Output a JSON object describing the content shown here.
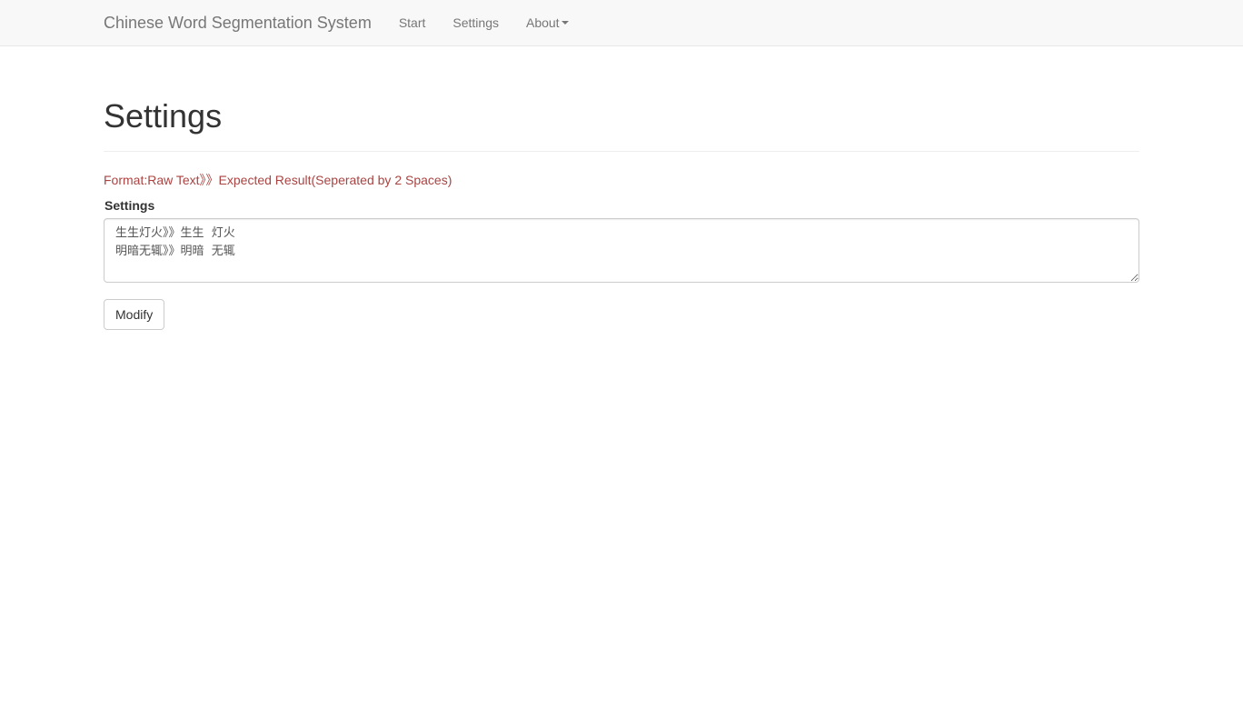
{
  "navbar": {
    "brand": "Chinese Word Segmentation System",
    "links": [
      "Start",
      "Settings",
      "About"
    ]
  },
  "page": {
    "title": "Settings",
    "format_hint": "Format:Raw Text》》Expected Result(Seperated by 2 Spaces)",
    "field_label": "Settings",
    "textarea_value": "生生灯火》》生生  灯火\n明暗无辄》》明暗  无辄",
    "button_label": "Modify"
  },
  "colors": {
    "navbar_bg": "#f8f8f8",
    "hint_text": "#a94442",
    "link_text": "#777777"
  }
}
